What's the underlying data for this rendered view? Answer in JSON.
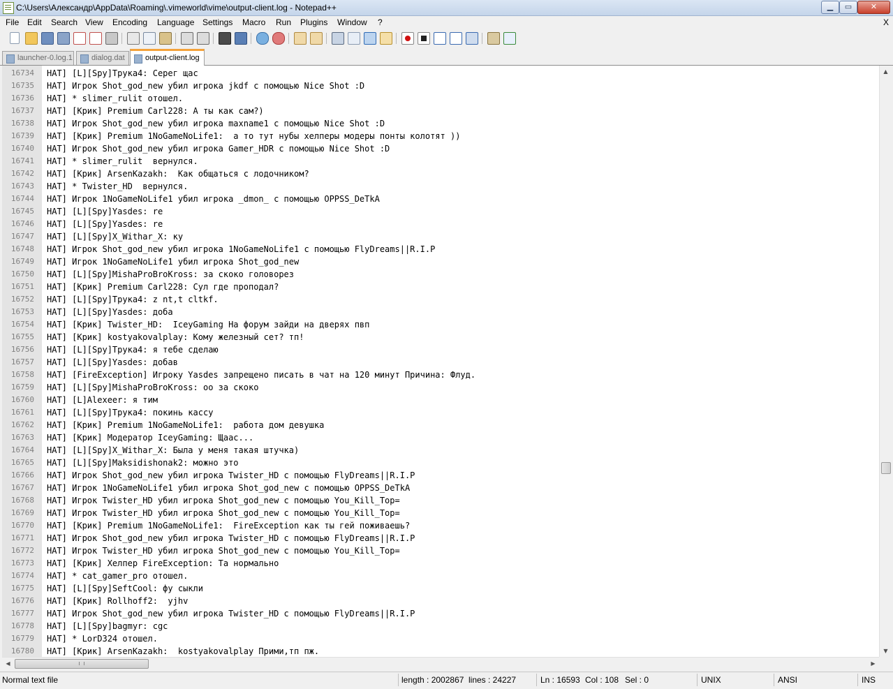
{
  "window": {
    "title": "C:\\Users\\Александр\\AppData\\Roaming\\.vimeworld\\vime\\output-client.log - Notepad++",
    "min_symbol": "▁",
    "max_symbol": "▭",
    "close_symbol": "✕"
  },
  "menu": {
    "items": [
      "File",
      "Edit",
      "Search",
      "View",
      "Encoding",
      "Language",
      "Settings",
      "Macro",
      "Run",
      "Plugins",
      "Window",
      "?"
    ],
    "close": "X"
  },
  "toolbar": {
    "icons": [
      "new-file-icon",
      "open-file-icon",
      "save-icon",
      "save-all-icon",
      "close-icon",
      "close-all-icon",
      "print-icon",
      "cut-icon",
      "copy-icon",
      "paste-icon",
      "undo-icon",
      "redo-icon",
      "find-icon",
      "replace-icon",
      "zoom-in-icon",
      "zoom-out-icon",
      "sync-vertical-icon",
      "sync-horizontal-icon",
      "word-wrap-icon",
      "show-all-chars-icon",
      "indent-guide-icon",
      "document-map-icon",
      "record-macro-icon",
      "stop-macro-icon",
      "play-macro-icon",
      "run-macro-multiple-icon",
      "save-macro-icon",
      "launch-browser-icon",
      "spell-check-icon"
    ]
  },
  "tabs": [
    {
      "label": "launcher-0.log.1",
      "active": false
    },
    {
      "label": "dialog.dat",
      "active": false
    },
    {
      "label": "output-client.log",
      "active": true
    }
  ],
  "editor": {
    "lines": [
      {
        "n": "16734",
        "text": "HAT] [L][Spy]Трука4: Серег щас"
      },
      {
        "n": "16735",
        "text": "HAT] Игрок Shot_god_new убил игрока jkdf с помощью Nice Shot :D"
      },
      {
        "n": "16736",
        "text": "HAT] * slimer_rulit отошел."
      },
      {
        "n": "16737",
        "text": "HAT] [Крик] Premium Carl228: А ты как сам?)"
      },
      {
        "n": "16738",
        "text": "HAT] Игрок Shot_god_new убил игрока maxname1 с помощью Nice Shot :D"
      },
      {
        "n": "16739",
        "text": "HAT] [Крик] Premium 1NoGameNoLife1:  а то тут нубы хелперы модеры понты колотят ))"
      },
      {
        "n": "16740",
        "text": "HAT] Игрок Shot_god_new убил игрока Gamer_HDR с помощью Nice Shot :D"
      },
      {
        "n": "16741",
        "text": "HAT] * slimer_rulit  вернулся."
      },
      {
        "n": "16742",
        "text": "HAT] [Крик] ArsenKazakh:  Как общаться с лодочником?"
      },
      {
        "n": "16743",
        "text": "HAT] * Twister_HD  вернулся."
      },
      {
        "n": "16744",
        "text": "HAT] Игрок 1NoGameNoLife1 убил игрока _dmon_ с помощью OPPSS_DeTkA"
      },
      {
        "n": "16745",
        "text": "HAT] [L][Spy]Yasdes: re"
      },
      {
        "n": "16746",
        "text": "HAT] [L][Spy]Yasdes: re"
      },
      {
        "n": "16747",
        "text": "HAT] [L][Spy]X_Withar_X: ку"
      },
      {
        "n": "16748",
        "text": "HAT] Игрок Shot_god_new убил игрока 1NoGameNoLife1 с помощью FlyDreams||R.I.P"
      },
      {
        "n": "16749",
        "text": "HAT] Игрок 1NoGameNoLife1 убил игрока Shot_god_new"
      },
      {
        "n": "16750",
        "text": "HAT] [L][Spy]MishaProBroKross: за скоко головорез"
      },
      {
        "n": "16751",
        "text": "HAT] [Крик] Premium Carl228: Сул где проподал?"
      },
      {
        "n": "16752",
        "text": "HAT] [L][Spy]Трука4: z nt,t cltkf."
      },
      {
        "n": "16753",
        "text": "HAT] [L][Spy]Yasdes: доба"
      },
      {
        "n": "16754",
        "text": "HAT] [Крик] Twister_HD:  IceyGaming На форум зайди на дверях пвп"
      },
      {
        "n": "16755",
        "text": "HAT] [Крик] kostyakovalplay: Кому железный сет? тп!"
      },
      {
        "n": "16756",
        "text": "HAT] [L][Spy]Трука4: я тебе сделаю"
      },
      {
        "n": "16757",
        "text": "HAT] [L][Spy]Yasdes: добав"
      },
      {
        "n": "16758",
        "text": "HAT] [FireException] Игроку Yasdes запрещено писать в чат на 120 минут Причина: Флуд."
      },
      {
        "n": "16759",
        "text": "HAT] [L][Spy]MishaProBroKross: оо за скоко"
      },
      {
        "n": "16760",
        "text": "HAT] [L]Alexeer: я тим"
      },
      {
        "n": "16761",
        "text": "HAT] [L][Spy]Трука4: покинь кассу"
      },
      {
        "n": "16762",
        "text": "HAT] [Крик] Premium 1NoGameNoLife1:  работа дом девушка"
      },
      {
        "n": "16763",
        "text": "HAT] [Крик] Модератор IceyGaming: Щаас..."
      },
      {
        "n": "16764",
        "text": "HAT] [L][Spy]X_Withar_X: Была у меня такая штучка)"
      },
      {
        "n": "16765",
        "text": "HAT] [L][Spy]Maksidishonak2: можно это"
      },
      {
        "n": "16766",
        "text": "HAT] Игрок Shot_god_new убил игрока Twister_HD с помощью FlyDreams||R.I.P"
      },
      {
        "n": "16767",
        "text": "HAT] Игрок 1NoGameNoLife1 убил игрока Shot_god_new с помощью OPPSS_DeTkA"
      },
      {
        "n": "16768",
        "text": "HAT] Игрок Twister_HD убил игрока Shot_god_new с помощью You_Kill_Top="
      },
      {
        "n": "16769",
        "text": "HAT] Игрок Twister_HD убил игрока Shot_god_new с помощью You_Kill_Top="
      },
      {
        "n": "16770",
        "text": "HAT] [Крик] Premium 1NoGameNoLife1:  FireException как ты гей поживаешь?"
      },
      {
        "n": "16771",
        "text": "HAT] Игрок Shot_god_new убил игрока Twister_HD с помощью FlyDreams||R.I.P"
      },
      {
        "n": "16772",
        "text": "HAT] Игрок Twister_HD убил игрока Shot_god_new с помощью You_Kill_Top="
      },
      {
        "n": "16773",
        "text": "HAT] [Крик] Хелпер FireException: Та нормально"
      },
      {
        "n": "16774",
        "text": "HAT] * cat_gamer_pro отошел."
      },
      {
        "n": "16775",
        "text": "HAT] [L][Spy]SeftCool: фу сыкли"
      },
      {
        "n": "16776",
        "text": "HAT] [Крик] Rollhoff2:  yjhv"
      },
      {
        "n": "16777",
        "text": "HAT] Игрок Shot_god_new убил игрока Twister_HD с помощью FlyDreams||R.I.P"
      },
      {
        "n": "16778",
        "text": "HAT] [L][Spy]bagmyr: cgc"
      },
      {
        "n": "16779",
        "text": "HAT] * LorD324 отошел."
      },
      {
        "n": "16780",
        "text": "HAT] [Крик] ArsenKazakh:  kostyakovalplay Прими,тп пж."
      }
    ]
  },
  "scrollbar": {
    "up": "▲",
    "down": "▼",
    "left": "◀",
    "right": "▶"
  },
  "status": {
    "file_type": "Normal text file",
    "length": "length : 2002867",
    "lines": "lines : 24227",
    "ln": "Ln : 16593",
    "col": "Col : 108",
    "sel": "Sel : 0",
    "eol": "UNIX",
    "encoding": "ANSI",
    "mode": "INS"
  }
}
